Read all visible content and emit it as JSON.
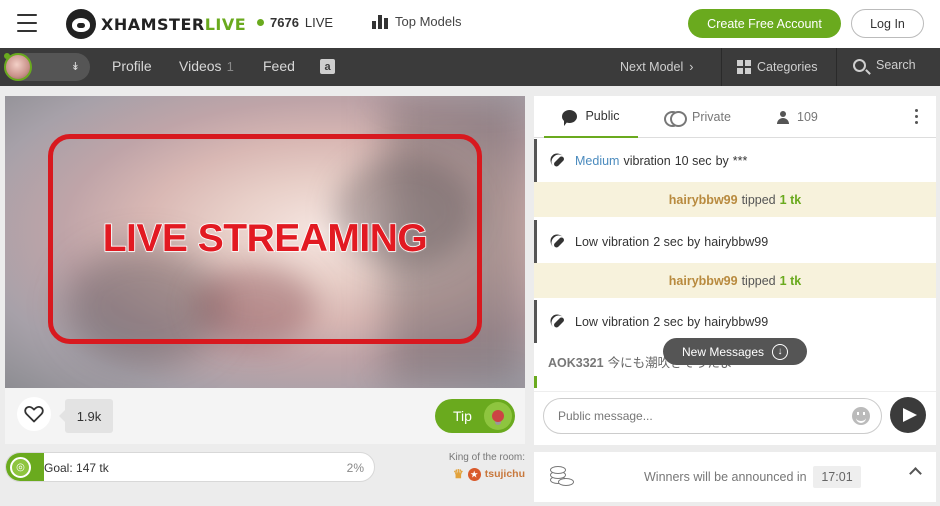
{
  "header": {
    "logo_part1": "XHAMSTER",
    "logo_part2": "LIVE",
    "live_count": "7676",
    "live_label": "LIVE",
    "top_models": "Top Models",
    "create_account": "Create Free Account",
    "login": "Log In"
  },
  "nav": {
    "profile": "Profile",
    "videos": "Videos",
    "videos_count": "1",
    "feed": "Feed",
    "amazon_letter": "a",
    "next_model": "Next Model",
    "categories": "Categories",
    "search": "Search"
  },
  "video": {
    "overlay_text": "LIVE STREAMING"
  },
  "controls": {
    "likes": "1.9k",
    "tip_label": "Tip",
    "goal_label": "Goal: 147 tk",
    "goal_percent": "2%",
    "goal_fraction": 0.02,
    "king_label": "King of the room:",
    "king_user": "tsujichu"
  },
  "chat": {
    "tabs": {
      "public": "Public",
      "private": "Private",
      "users_count": "109"
    },
    "messages": [
      {
        "type": "vibration",
        "level": "Medium",
        "text_mid": "vibration",
        "duration": "10 sec",
        "by": "by",
        "user": "***"
      },
      {
        "type": "tip",
        "user": "hairybbw99",
        "verb": "tipped",
        "amount": "1 tk"
      },
      {
        "type": "vibration",
        "level": "Low",
        "text_mid": "vibration",
        "duration": "2 sec",
        "by": "by",
        "user": "hairybbw99"
      },
      {
        "type": "tip",
        "user": "hairybbw99",
        "verb": "tipped",
        "amount": "1 tk"
      },
      {
        "type": "vibration",
        "level": "Low",
        "text_mid": "vibration",
        "duration": "2 sec",
        "by": "by",
        "user": "hairybbw99"
      }
    ],
    "jp_message": {
      "user": "AOK3321",
      "text": "今にも潮吹きそうだよ"
    },
    "new_messages": "New Messages",
    "input_placeholder": "Public message..."
  },
  "winners": {
    "text": "Winners will be announced in",
    "timer": "17:01"
  },
  "colors": {
    "brand_green": "#6aaa1e",
    "nav_dark": "#3b3b3b",
    "overlay_red": "#d8191f"
  }
}
